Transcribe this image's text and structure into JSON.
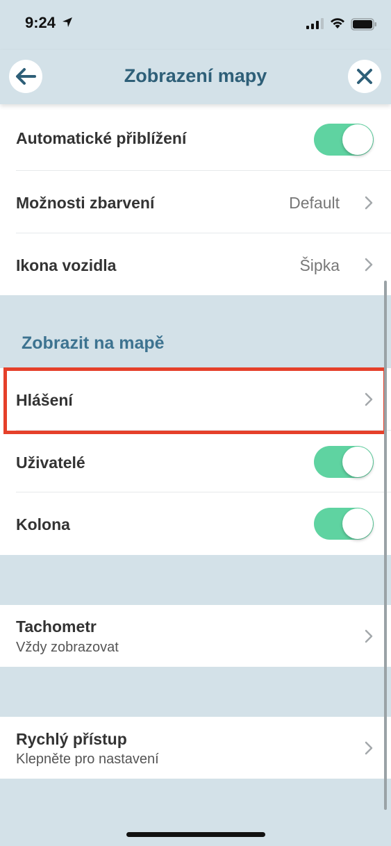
{
  "status_bar": {
    "time": "9:24",
    "icons": [
      "location-arrow-icon",
      "cellular-signal-icon",
      "wifi-icon",
      "battery-icon"
    ]
  },
  "header": {
    "title": "Zobrazení mapy",
    "back_icon": "arrow-left-icon",
    "close_icon": "close-icon"
  },
  "settings": {
    "auto_zoom": {
      "label": "Automatické přiblížení",
      "enabled": true
    },
    "color_options": {
      "label": "Možnosti zbarvení",
      "value": "Default"
    },
    "vehicle_icon": {
      "label": "Ikona vozidla",
      "value": "Šipka"
    }
  },
  "show_on_map": {
    "section_title": "Zobrazit na mapě",
    "reports": {
      "label": "Hlášení"
    },
    "users": {
      "label": "Uživatelé",
      "enabled": true
    },
    "convoy": {
      "label": "Kolona",
      "enabled": true
    }
  },
  "speedometer": {
    "label": "Tachometr",
    "subtitle": "Vždy zobrazovat"
  },
  "quick_access": {
    "label": "Rychlý přístup",
    "subtitle": "Klepněte pro nastavení"
  },
  "colors": {
    "background": "#d3e1e8",
    "title": "#2e5f78",
    "section_title": "#3d7390",
    "toggle_on": "#5fd3a1",
    "highlight_border": "#e5402a"
  }
}
